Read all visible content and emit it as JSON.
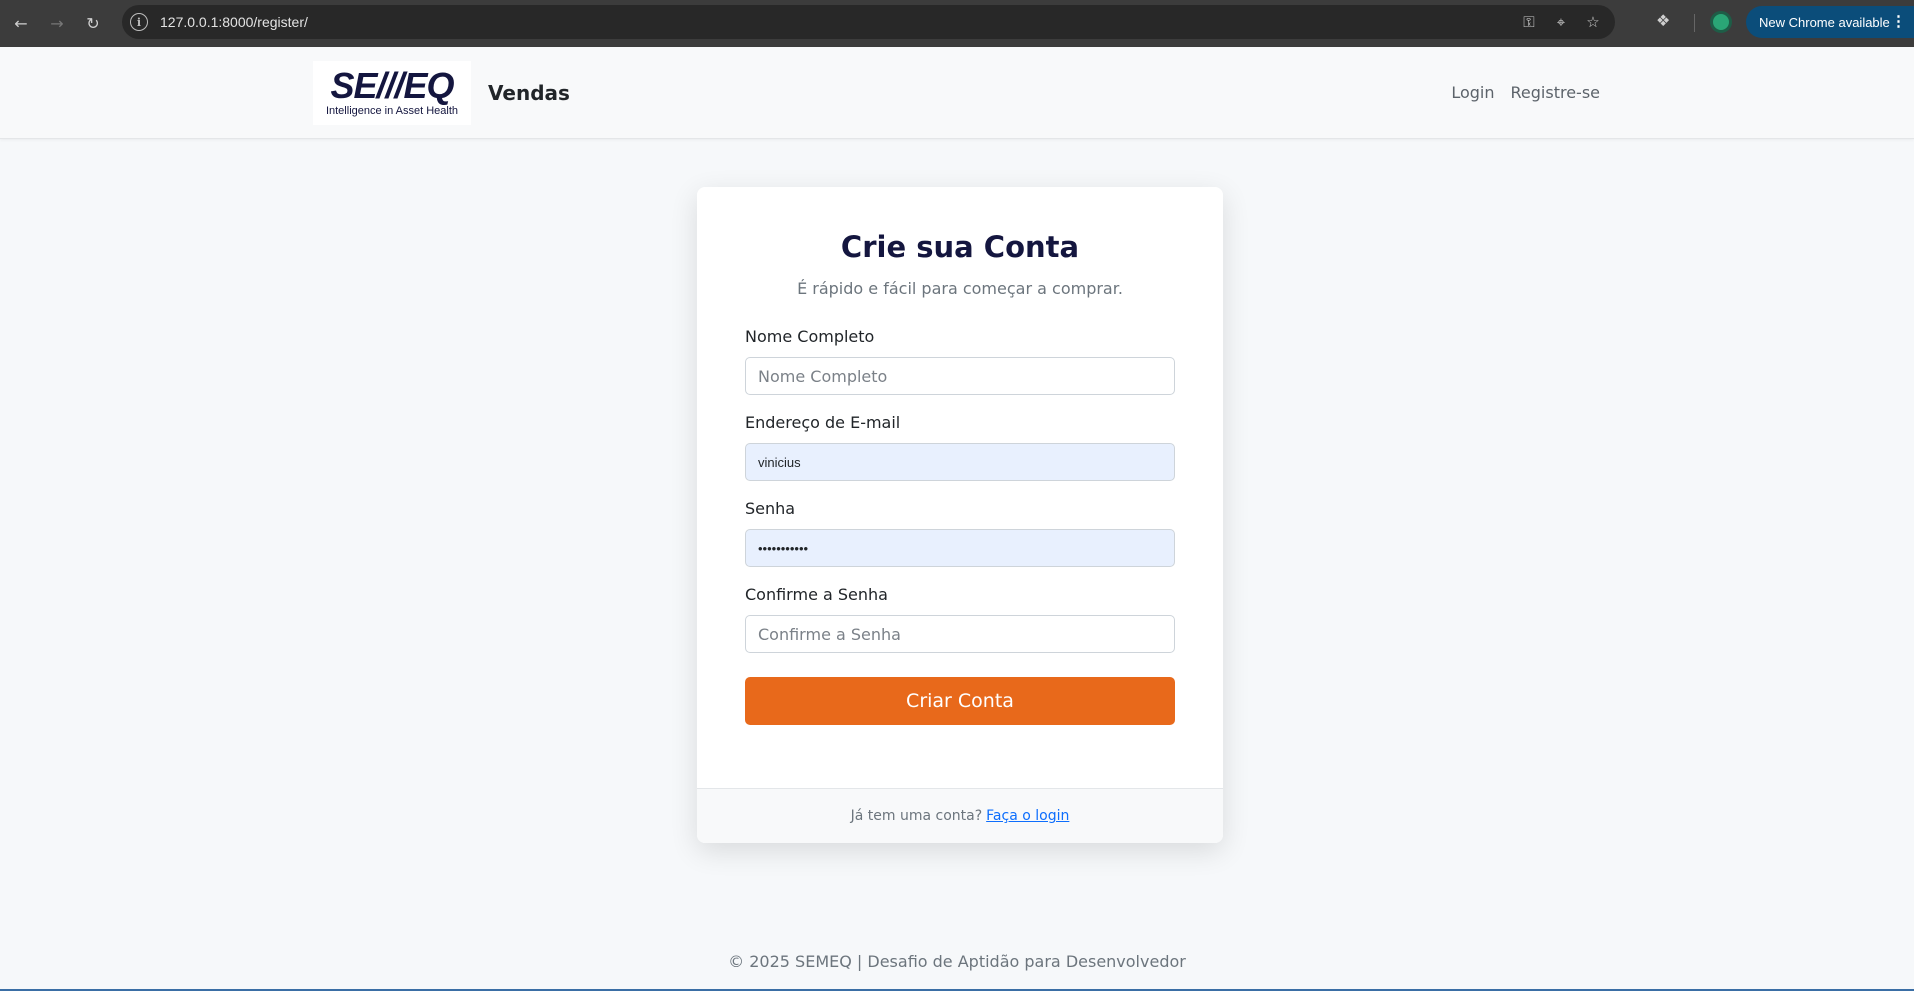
{
  "browser": {
    "url": "127.0.0.1:8000/register/",
    "update_label": "New Chrome available"
  },
  "header": {
    "logo_text": "SE///EQ",
    "logo_tagline": "Intelligence in Asset Health",
    "brand": "Vendas",
    "nav": {
      "login": "Login",
      "register": "Registre-se"
    }
  },
  "form": {
    "title": "Crie sua Conta",
    "subtitle": "É rápido e fácil para começar a comprar.",
    "name_label": "Nome Completo",
    "name_placeholder": "Nome Completo",
    "name_value": "",
    "email_label": "Endereço de E-mail",
    "email_value": "vinicius",
    "password_label": "Senha",
    "password_value": "•••••••••••",
    "confirm_label": "Confirme a Senha",
    "confirm_placeholder": "Confirme a Senha",
    "confirm_value": "",
    "submit_label": "Criar Conta",
    "footer_text": "Já tem uma conta?",
    "footer_link": "Faça o login"
  },
  "footer": {
    "text": "© 2025 SEMEQ | Desafio de Aptidão para Desenvolvedor"
  },
  "colors": {
    "accent": "#e8691b",
    "brand_navy": "#14163f",
    "link": "#0d6efd",
    "autofill": "#e8f0fe"
  }
}
